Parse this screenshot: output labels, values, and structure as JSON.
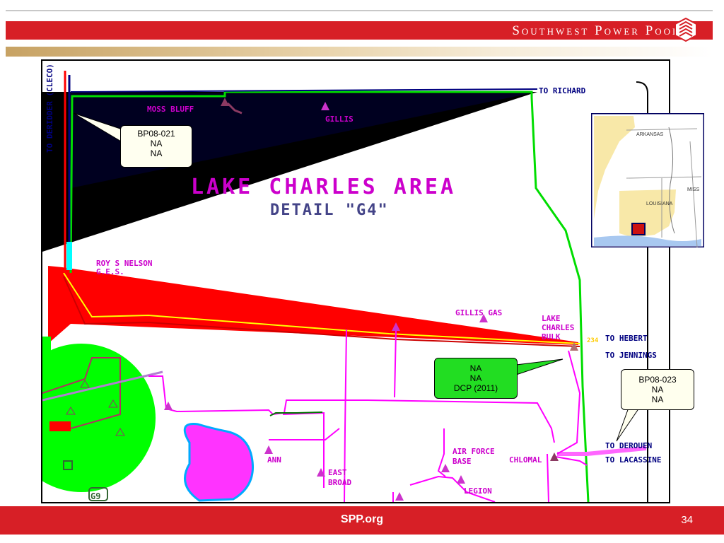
{
  "header": {
    "title": "Southwest Power Pool",
    "colors": {
      "red": "#d71f26",
      "gold": "#c7a263"
    }
  },
  "map": {
    "title": "LAKE CHARLES AREA",
    "subtitle": "DETAIL \"G4\"",
    "labels": {
      "to_richard": "TO RICHARD",
      "moss_bluff": "MOSS BLUFF",
      "gillis": "GILLIS",
      "to_deridder": "TO DERIDDER (CLECO)",
      "roy_s_nelson": "ROY S NELSON",
      "ges": "G.E.S.",
      "gillis_gas": "GILLIS GAS",
      "lake_charles_bulk_1": "LAKE",
      "lake_charles_bulk_2": "CHARLES",
      "lake_charles_bulk_3": "BULK",
      "kv_tag": "234",
      "to_hebert": "TO HEBERT",
      "to_jennings": "TO JENNINGS",
      "to_derouen": "TO DEROUEN",
      "to_lacassine": "TO LACASSINE",
      "air_force_base_1": "AIR FORCE",
      "air_force_base_2": "BASE",
      "chlomal": "CHLOMAL",
      "legion": "LEGION",
      "ann": "ANN",
      "east_broad_1": "EAST",
      "east_broad_2": "BROAD",
      "g9": "G9",
      "inset_arkansas": "ARKANSAS",
      "inset_louisiana": "LOUISIANA",
      "inset_miss": "MISS"
    },
    "colors": {
      "magenta": "#ff00ff",
      "green": "#00ff00",
      "red": "#ff0000",
      "black": "#000000",
      "cyan": "#00ffff",
      "navy": "#000080",
      "substation": "#8b3a62"
    }
  },
  "callouts": {
    "bp08_021": {
      "line1": "BP08-021",
      "line2": "NA",
      "line3": "NA"
    },
    "dcp": {
      "line1": "NA",
      "line2": "NA",
      "line3": "DCP (2011)"
    },
    "bp08_023": {
      "line1": "BP08-023",
      "line2": "NA",
      "line3": "NA"
    }
  },
  "footer": {
    "site": "SPP.org",
    "page_number": "34"
  }
}
